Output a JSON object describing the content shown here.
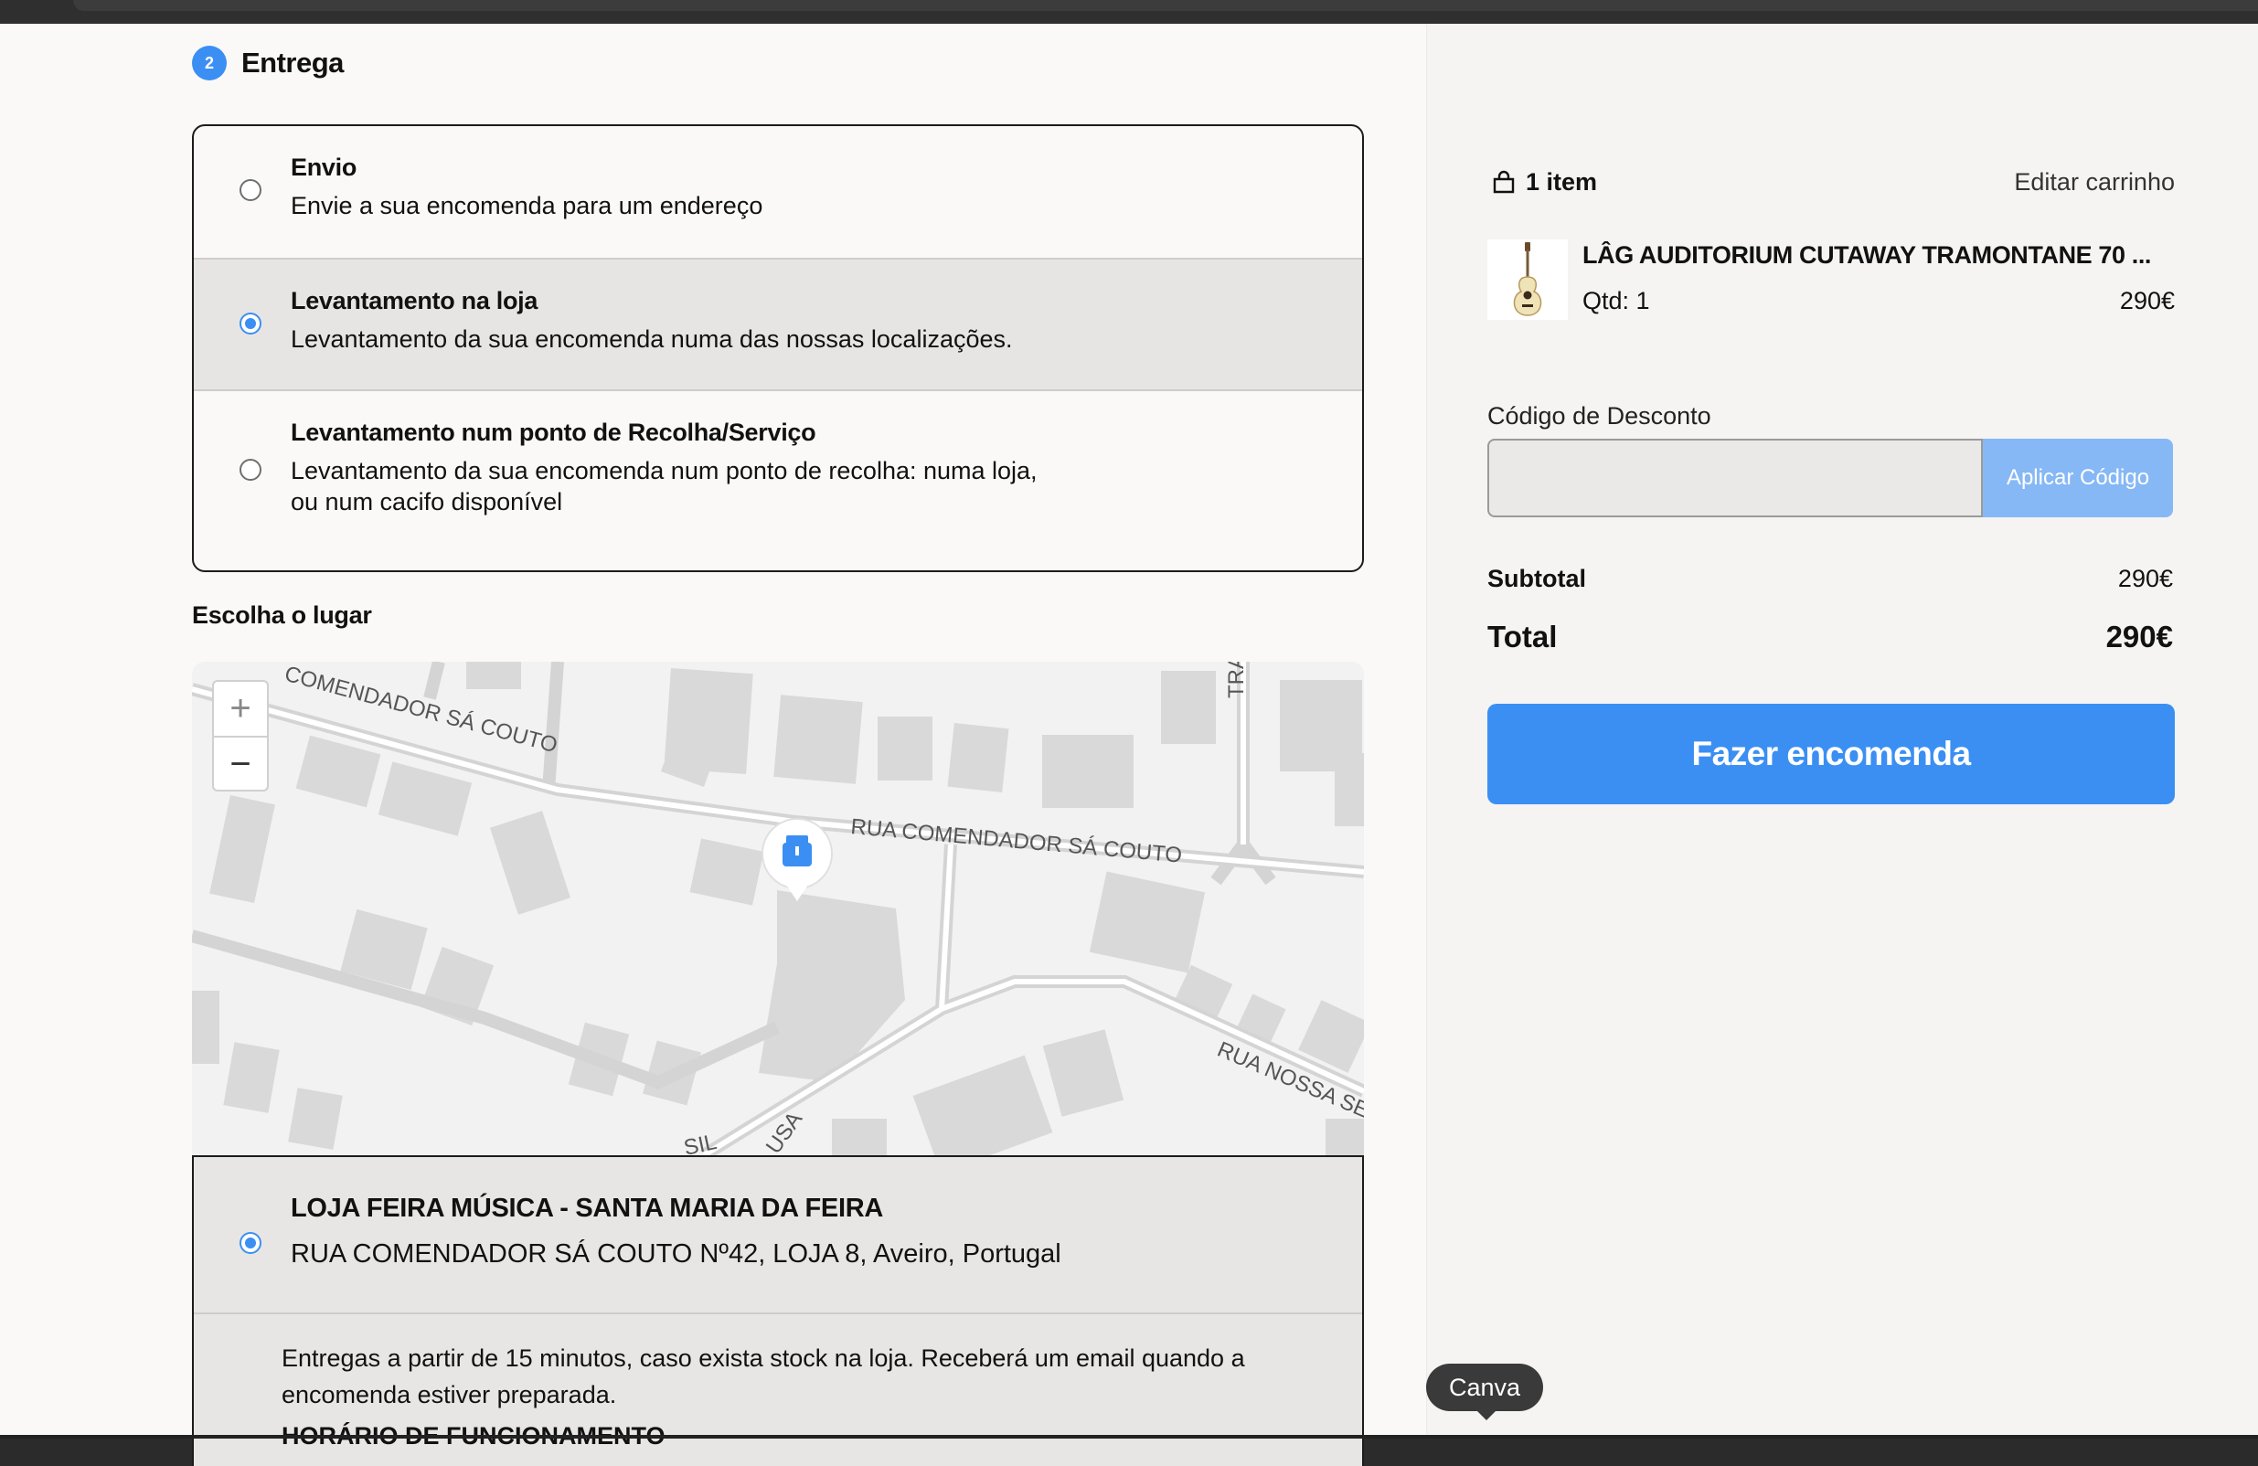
{
  "delivery": {
    "step_number": "2",
    "step_title": "Entrega",
    "options": [
      {
        "title": "Envio",
        "desc": "Envie a sua encomenda para um endereço",
        "selected": false
      },
      {
        "title": "Levantamento na loja",
        "desc": "Levantamento da sua encomenda numa das nossas localizações.",
        "selected": true
      },
      {
        "title": "Levantamento num ponto de Recolha/Serviço",
        "desc_line1": "Levantamento da sua encomenda num ponto de recolha: numa loja,",
        "desc_line2": "ou num cacifo disponível",
        "selected": false
      }
    ],
    "choose_place_label": "Escolha o lugar"
  },
  "map": {
    "zoom_in": "+",
    "zoom_out": "−",
    "street_labels": [
      "COMENDADOR SÁ COUTO",
      "RUA COMENDADOR SÁ COUTO",
      "TRA",
      "RUA NOSSA SENI",
      "SIL",
      "USA"
    ],
    "marker_icon": "store-pin-icon"
  },
  "store": {
    "name": "LOJA FEIRA MÚSICA - SANTA MARIA DA FEIRA",
    "address": "RUA COMENDADOR SÁ COUTO Nº42, LOJA 8, Aveiro, Portugal",
    "info": "Entregas a partir de 15 minutos, caso exista stock na loja. Receberá um email quando a encomenda estiver preparada.",
    "hours_label": "HORÁRIO DE FUNCIONAMENTO"
  },
  "cart": {
    "count_label": "1 item",
    "edit_label": "Editar carrinho",
    "item": {
      "name": "LÂG AUDITORIUM CUTAWAY TRAMONTANE 70 ...",
      "qty": "Qtd: 1",
      "price": "290€"
    },
    "discount_label": "Código de Desconto",
    "discount_placeholder": "",
    "apply_label": "Aplicar Código",
    "subtotal_label": "Subtotal",
    "subtotal_value": "290€",
    "total_label": "Total",
    "total_value": "290€",
    "order_button": "Fazer encomenda"
  },
  "tooltip": "Canva",
  "colors": {
    "accent": "#3b8ff3",
    "accent_light": "#86b8f5",
    "selected_bg": "#e7e5e4"
  }
}
